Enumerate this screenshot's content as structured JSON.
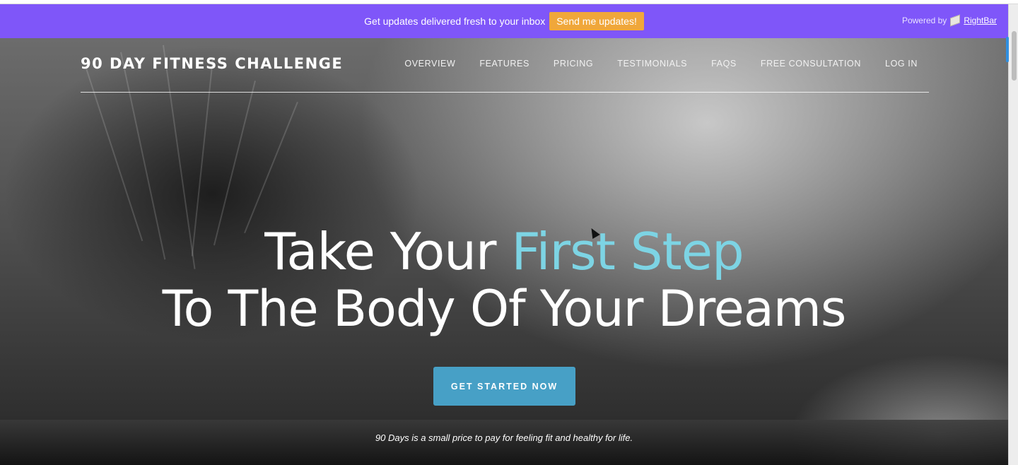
{
  "rightbar": {
    "message": "Get updates delivered fresh to your inbox",
    "button_label": "Send me updates!",
    "powered_by": "Powered by",
    "powered_brand": "RightBar",
    "color": "#7f56f9",
    "button_color": "#f0a73a"
  },
  "nav": {
    "brand": "90 DAY FITNESS CHALLENGE",
    "items": [
      {
        "label": "OVERVIEW"
      },
      {
        "label": "FEATURES"
      },
      {
        "label": "PRICING"
      },
      {
        "label": "TESTIMONIALS"
      },
      {
        "label": "FAQS"
      },
      {
        "label": "FREE CONSULTATION"
      },
      {
        "label": "LOG IN"
      }
    ]
  },
  "hero": {
    "line1_prefix": "Take Your ",
    "line1_accent": "First Step",
    "line2": "To The Body Of Your Dreams",
    "cta_label": "GET STARTED NOW",
    "tagline": "90 Days is a small price to pay for feeling fit and healthy for life.",
    "accent_color": "#7dd4e4",
    "cta_color": "#47a0c6"
  }
}
